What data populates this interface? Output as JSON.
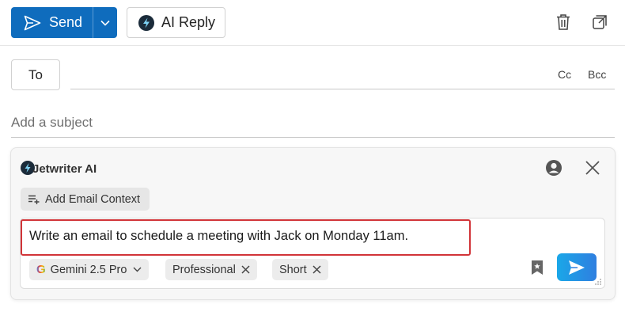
{
  "toolbar": {
    "send_label": "Send",
    "ai_reply_label": "AI Reply",
    "icons": [
      "send-icon",
      "chevron-down-icon",
      "bolt-icon",
      "trash-icon",
      "popout-icon"
    ]
  },
  "recipients": {
    "to_label": "To",
    "cc_label": "Cc",
    "bcc_label": "Bcc",
    "subject_placeholder": "Add a subject"
  },
  "ai_panel": {
    "title": "Jetwriter AI",
    "add_context_label": "Add Email Context",
    "prompt_text": "Write an email to schedule a meeting with Jack on Monday 11am.",
    "model": "Gemini 2.5 Pro",
    "tone": "Professional",
    "length": "Short"
  },
  "colors": {
    "primary": "#0f6cbd",
    "highlight_border": "#d13438",
    "send_gradient_start": "#1aa7e8",
    "send_gradient_end": "#2f7fe0"
  }
}
